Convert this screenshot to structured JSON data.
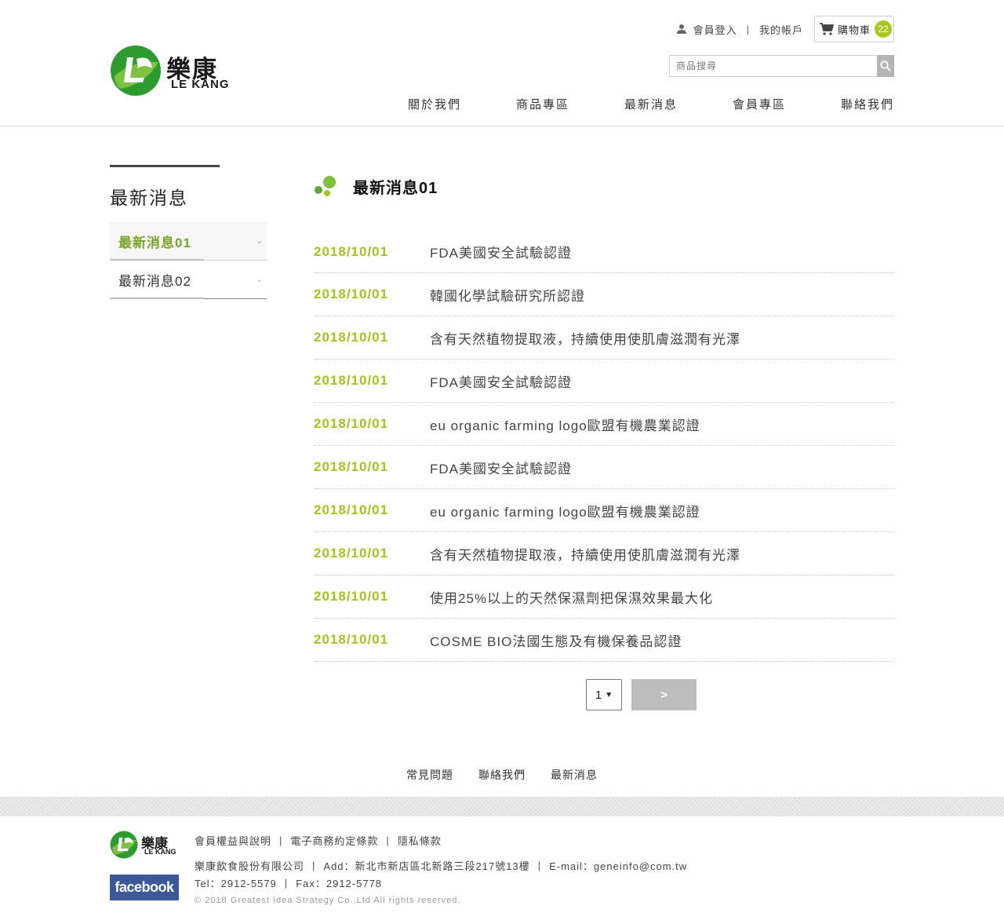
{
  "brand": {
    "name_cn": "樂康",
    "name_en": "LE KANG",
    "green": "#2e9b2f",
    "accent": "#a3c31f"
  },
  "topbar": {
    "login_icon": "person-icon",
    "login_label": "會員登入",
    "account_label": "我的帳戶",
    "cart_icon": "shopping-cart-icon",
    "cart_label": "購物車",
    "cart_count": "22"
  },
  "search": {
    "placeholder": "商品搜尋",
    "icon": "search-icon"
  },
  "nav": [
    {
      "label": "關於我們"
    },
    {
      "label": "商品專區"
    },
    {
      "label": "最新消息"
    },
    {
      "label": "會員專區"
    },
    {
      "label": "聯絡我們"
    }
  ],
  "sidebar": {
    "title": "最新消息",
    "items": [
      {
        "label": "最新消息01",
        "active": true
      },
      {
        "label": "最新消息02",
        "active": false
      }
    ]
  },
  "main": {
    "title": "最新消息01",
    "news": [
      {
        "date": "2018/10/01",
        "title": "FDA美國安全試驗認證"
      },
      {
        "date": "2018/10/01",
        "title": "韓國化學試驗研究所認證"
      },
      {
        "date": "2018/10/01",
        "title": "含有天然植物提取液，持續使用使肌膚滋潤有光澤"
      },
      {
        "date": "2018/10/01",
        "title": "FDA美國安全試驗認證"
      },
      {
        "date": "2018/10/01",
        "title": "eu organic farming logo歐盟有機農業認證"
      },
      {
        "date": "2018/10/01",
        "title": "FDA美國安全試驗認證"
      },
      {
        "date": "2018/10/01",
        "title": "eu organic farming logo歐盟有機農業認證"
      },
      {
        "date": "2018/10/01",
        "title": "含有天然植物提取液，持續使用使肌膚滋潤有光澤"
      },
      {
        "date": "2018/10/01",
        "title": "使用25%以上的天然保濕劑把保濕效果最大化"
      },
      {
        "date": "2018/10/01",
        "title": "COSME BIO法國生態及有機保養品認證"
      }
    ]
  },
  "pager": {
    "current_page": "1",
    "next_label": ">"
  },
  "footer": {
    "links": [
      {
        "label": "常見問題"
      },
      {
        "label": "聯絡我們"
      },
      {
        "label": "最新消息"
      }
    ],
    "policy_links": [
      {
        "label": "會員權益與說明"
      },
      {
        "label": "電子商務約定條款"
      },
      {
        "label": "隱私條款"
      }
    ],
    "company": "樂康飲食股份有限公司",
    "address": "Add：新北市新店區北新路三段217號13樓",
    "email": "E-mail：geneinfo@com.tw",
    "tel": "Tel：2912-5579",
    "fax": "Fax：2912-5778",
    "copyright": "© 2018 Greatest Idea Strategy Co.,Ltd All rights reserved.",
    "facebook_label": "facebook"
  }
}
